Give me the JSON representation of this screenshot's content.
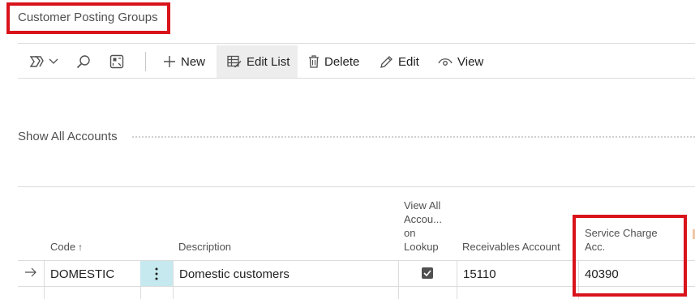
{
  "page": {
    "title": "Customer Posting Groups"
  },
  "toolbar": {
    "new_label": "New",
    "edit_list_label": "Edit List",
    "delete_label": "Delete",
    "edit_label": "Edit",
    "view_label": "View"
  },
  "section": {
    "title": "Show All Accounts"
  },
  "table": {
    "headers": {
      "code": "Code",
      "description": "Description",
      "view_all_1": "View All",
      "view_all_2": "Accou...",
      "view_all_3": "on",
      "view_all_4": "Lookup",
      "receivables": "Receivables Account",
      "service_charge_1": "Service Charge",
      "service_charge_2": "Acc."
    },
    "sort_indicator": "↑",
    "rows": [
      {
        "code": "DOMESTIC",
        "description": "Domestic customers",
        "view_all_checked": true,
        "receivables": "15110",
        "service_charge": "40390"
      }
    ]
  },
  "colors": {
    "highlight": "#d9131b",
    "selected_cell": "#c5e9ef",
    "toolbar_active": "#ededed"
  }
}
